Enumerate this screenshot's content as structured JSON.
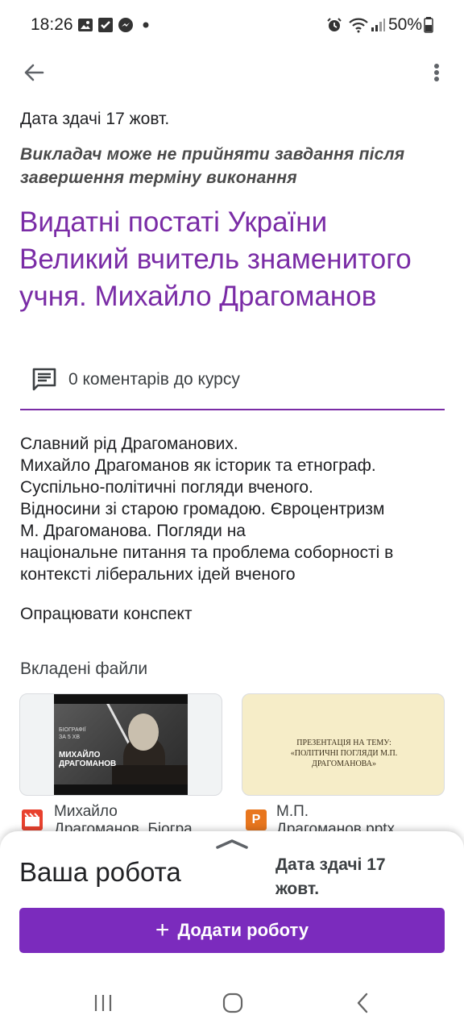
{
  "status_bar": {
    "time": "18:26",
    "battery": "50%",
    "icons": [
      "image-icon",
      "check-icon",
      "messenger-icon",
      "dot-icon",
      "alarm-icon",
      "wifi-icon",
      "signal-icon",
      "battery-icon"
    ]
  },
  "toolbar": {
    "back_icon": "arrow-back-icon",
    "more_icon": "more-vert-icon"
  },
  "assignment": {
    "due_date": "Дата здачі 17 жовт.",
    "late_note": "Викладач може не прийняти завдання після завершення терміну виконання",
    "title_lines": [
      "Видатні постаті України",
      "Великий вчитель знаменитого",
      "учня. Михайло Драгоманов"
    ],
    "comments_label": "0 коментарів до курсу",
    "description_lines": [
      "Славний рід Драгоманових.",
      "Михайло Драгоманов як історик та етнограф.",
      "Суспільно-політичні погляди вченого.",
      "Відносини зі старою громадою. Євроцентризм",
      "М. Драгоманова. Погляди на",
      "національне питання та проблема соборності в",
      "контексті ліберальних ідей вченого"
    ],
    "task": "Опрацювати конспект",
    "attachments_heading": "Вкладені файли",
    "attachments": [
      {
        "name_lines": [
          "Михайло",
          "Драгоманов. Біогра"
        ],
        "type_icon": "video-file-icon",
        "thumb_small_text": [
          "БІОГРАФІЇ",
          "ЗА 5 ХВ"
        ],
        "thumb_title": [
          "МИХАЙЛО",
          "ДРАГОМАНОВ"
        ]
      },
      {
        "name_lines": [
          "М.П.",
          "Драгоманов.pptx"
        ],
        "type_icon": "powerpoint-file-icon",
        "type_letter": "P",
        "thumb_text": [
          "ПРЕЗЕНТАЦІЯ НА ТЕМУ:",
          "«ПОЛІТИЧНІ ПОГЛЯДИ М.П.",
          "ДРАГОМАНОВА»"
        ]
      }
    ]
  },
  "sheet": {
    "your_work": "Ваша робота",
    "due_lines": [
      "Дата здачі 17",
      "жовт."
    ],
    "add_plus": "+",
    "add_button": "Додати роботу"
  },
  "colors": {
    "accent": "#7a2ca6",
    "button": "#7b2bbd",
    "video_icon": "#e8412e",
    "pptx_icon": "#e8761e"
  }
}
